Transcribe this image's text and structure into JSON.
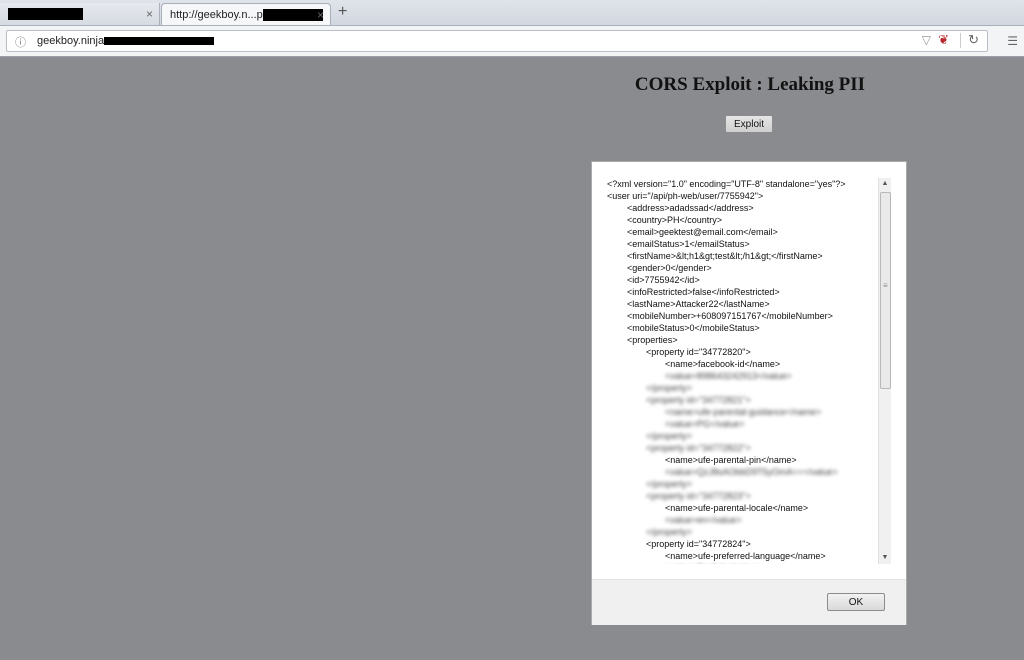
{
  "browser": {
    "tab1": {
      "title": "",
      "close": "×"
    },
    "tab2": {
      "title": "http://geekboy.n...p",
      "close": "×"
    },
    "new_tab": "+",
    "url": "geekboy.ninja",
    "info_icon": "info-icon",
    "star_icon": "bookmark-star-icon",
    "reload_icon": "reload-icon",
    "menu_icon": "hamburger-menu-icon"
  },
  "page": {
    "title": "CORS Exploit : Leaking PII",
    "exploit_button": "Exploit"
  },
  "dialog": {
    "ok_button": "OK",
    "lines": [
      {
        "t": "<?xml version=\"1.0\" encoding=\"UTF-8\" standalone=\"yes\"?>"
      },
      {
        "t": "<user uri=\"/api/ph-web/user/7755942\">"
      },
      {
        "t": "<address>adadssad</address>"
      },
      {
        "t": "<country>PH</country>"
      },
      {
        "t": "<email>geektest@email.com</email>"
      },
      {
        "t": "<emailStatus>1</emailStatus>"
      },
      {
        "t": "<firstName>&lt;h1&gt;test&lt;/h1&gt;</firstName>"
      },
      {
        "t": "<gender>0</gender>"
      },
      {
        "t": "<id>7755942</id>"
      },
      {
        "t": "<infoRestricted>false</infoRestricted>"
      },
      {
        "t": "<lastName>Attacker22</lastName>"
      },
      {
        "t": "<mobileNumber>+608097151767</mobileNumber>"
      },
      {
        "t": "<mobileStatus>0</mobileStatus>"
      },
      {
        "t": "<properties>"
      },
      {
        "t": "<property id=\"34772820\">"
      },
      {
        "t": "<name>facebook-id</name>"
      },
      {
        "t": "<value>898643242913</value>"
      },
      {
        "t": "</property>"
      },
      {
        "t": "<property id=\"34772821\">"
      },
      {
        "t": "<name>ufe-parental-guidance</name>"
      },
      {
        "t": "<value>PG</value>"
      },
      {
        "t": "</property>"
      },
      {
        "t": "<property id=\"34772822\">"
      },
      {
        "t": "<name>ufe-parental-pin</name>"
      },
      {
        "t": "<value>QzJ8sAObbD9T5yOmA==</value>"
      },
      {
        "t": "</property>"
      },
      {
        "t": "<property id=\"34772823\">"
      },
      {
        "t": "<name>ufe-parental-locale</name>"
      },
      {
        "t": "<value>en</value>"
      },
      {
        "t": "</property>"
      },
      {
        "t": "<property id=\"34772824\">"
      },
      {
        "t": "<name>ufe-preferred-language</name>"
      },
      {
        "t": "<value>English</value>"
      }
    ]
  }
}
